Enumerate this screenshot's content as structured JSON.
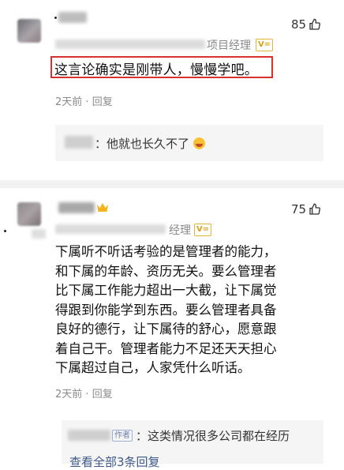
{
  "comments": [
    {
      "role_suffix": "项目经理",
      "badge": "V=",
      "likes": "85",
      "text": "这言论确实是刚带人，慢慢学吧。",
      "time": "2天前",
      "reply_label": "回复",
      "reply": {
        "author_suffix": "：",
        "text": "他就也长久不了"
      }
    },
    {
      "role_suffix": "经理",
      "badge": "V=",
      "likes": "75",
      "text_lines": [
        "下属听不听话考验的是管理者的能力，",
        "和下属的年龄、资历无关。要么管理者",
        "比下属工作能力超出一大截，让下属觉",
        "得跟到你能学到东西。要么管理者具备",
        "良好的德行，让下属待的舒心，愿意跟",
        "着自己干。管理者能力不足还天天担心",
        "下属超过自己，人家凭什么听话。"
      ],
      "time": "2天前",
      "reply_label": "回复",
      "reply": {
        "author_tag": "作者",
        "text": "这类情况很多公司都在经历"
      },
      "view_all": "查看全部3条回复"
    }
  ],
  "colors": {
    "highlight_border": "#d9312e",
    "badge_gold": "#d8a31c",
    "meta_gray": "#8a8a8a",
    "link_blue": "#3d5a8a"
  },
  "icons": [
    "thumbs-up-icon",
    "crown-icon",
    "grinning-emoji-icon"
  ]
}
